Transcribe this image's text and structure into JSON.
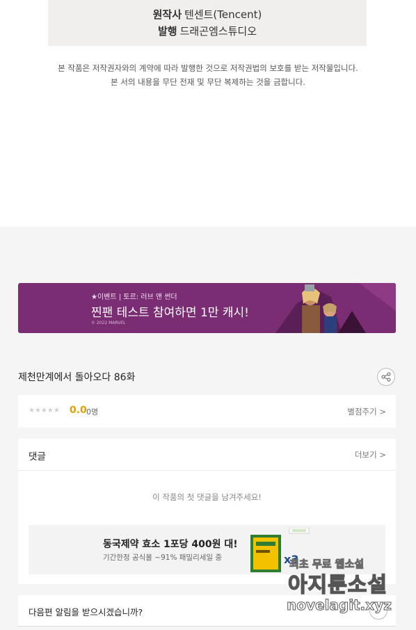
{
  "credits": {
    "author_label": "원작사",
    "author_value": "텐센트(Tencent)",
    "publisher_label": "발행",
    "publisher_value": "드래곤엠스튜디오"
  },
  "copyright": {
    "line1": "본 작품은 저작권자와의 계약에 따라 발행한 것으로 저작권법의 보호를 받는 저작물입니다.",
    "line2": "본 서의 내용을 무단 전재 및 무단 복제하는 것을 금합니다."
  },
  "banner": {
    "tag": "★이벤트 | 토르: 러브 앤 썬더",
    "title": "찐팬 테스트 참여하면 1만 캐시!",
    "copy": "© 2022 MARVEL",
    "color": "#7b2d74"
  },
  "episode": {
    "title": "제천만계에서 돌아오다 86화",
    "share_icon": "share-icon"
  },
  "rating": {
    "stars": "★★★★★",
    "score": "0.0",
    "count": "0명",
    "rate_link": "별점주기 >"
  },
  "comments": {
    "title": "댓글",
    "more_link": "더보기 >",
    "empty_message": "이 작품의 첫 댓글을 남겨주세요!"
  },
  "ad": {
    "title": "동국제약 효소 1포당 400원 대!",
    "subtitle": "기간한정 공식몰 ~91% 패밀리세일 중",
    "multiplier": "x3"
  },
  "notify": {
    "text": "다음편 알림을 받으시겠습니까?"
  },
  "watermark": {
    "line1": "최초 무료 웹소설",
    "line2": "아지툰소설",
    "line3": "novelagit.xyz"
  }
}
